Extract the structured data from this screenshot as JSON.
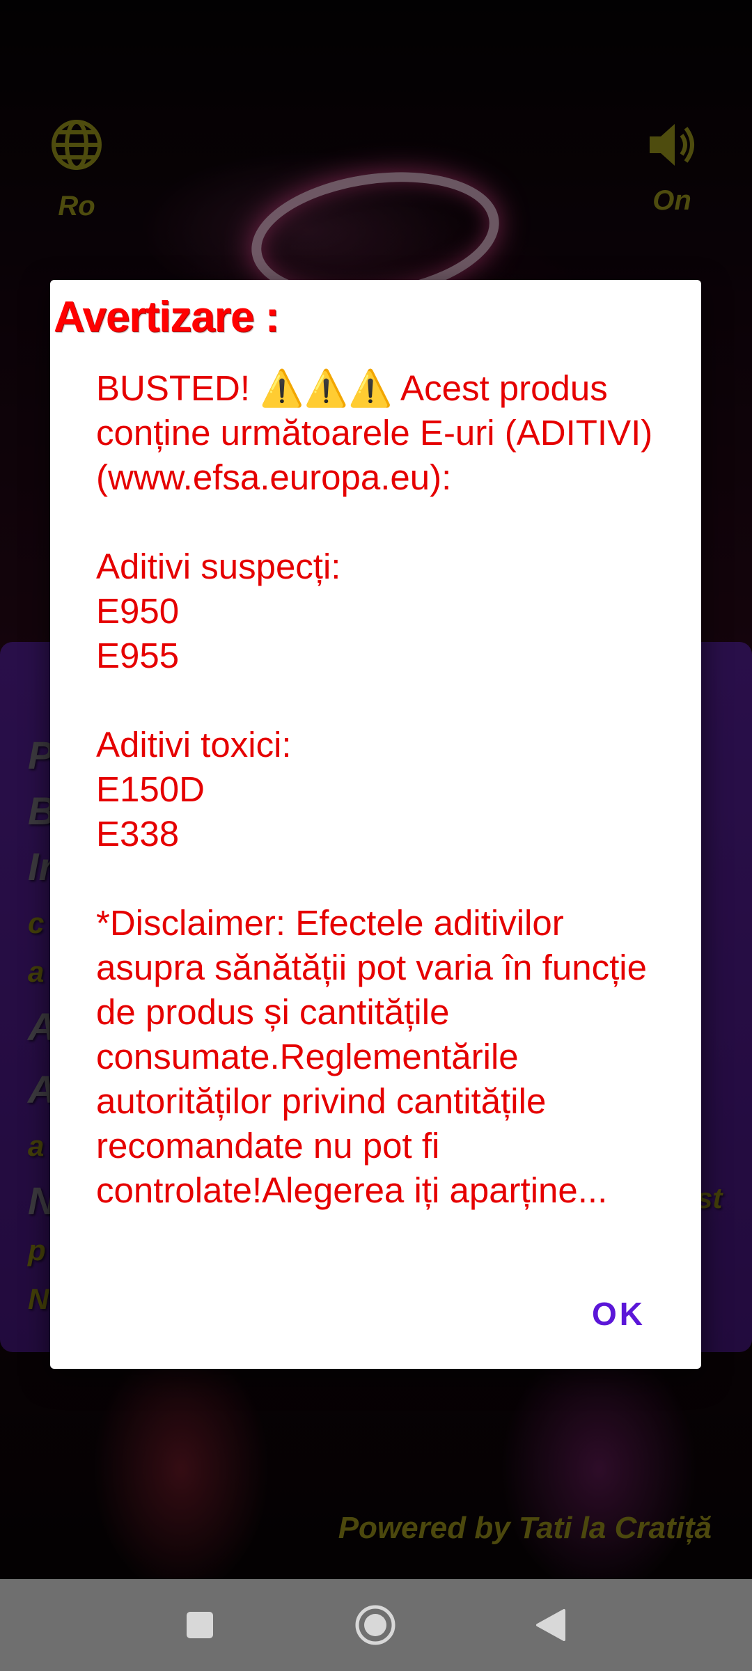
{
  "top_bar": {
    "language_label": "Ro",
    "sound_label": "On"
  },
  "background_card": {
    "visible_fragments": [
      "P",
      "B",
      "Ir",
      "c",
      "a",
      "A",
      "A",
      "a",
      "N",
      "st",
      "p",
      "N"
    ]
  },
  "footer": {
    "powered_by": "Powered by Tati la Cratiță"
  },
  "dialog": {
    "title": "Avertizare :",
    "message": "BUSTED! ⚠️⚠️⚠️ Acest produs conține următoarele E-uri (ADITIVI) (www.efsa.europa.eu):\n\nAditivi suspecți:\nE950\nE955\n\nAditivi toxici:\nE150D\nE338\n\n*Disclaimer: Efectele aditivilor asupra sănătății pot varia în funcție de produs și cantitățile consumate.Reglementările autorităților privind cantitățile recomandate nu pot fi controlate!Alegerea iți aparține...",
    "ok_label": "OK"
  },
  "colors": {
    "accent_olive": "#8f8a1a",
    "dialog_text_red": "#e50000",
    "ok_purple": "#5b16d8",
    "card_purple": "#4c1c86",
    "navbar_gray": "#6f6f6f"
  },
  "icons": {
    "language": "globe-icon",
    "sound": "speaker-icon",
    "recents": "square-icon",
    "home": "circle-icon",
    "back": "triangle-back-icon"
  }
}
